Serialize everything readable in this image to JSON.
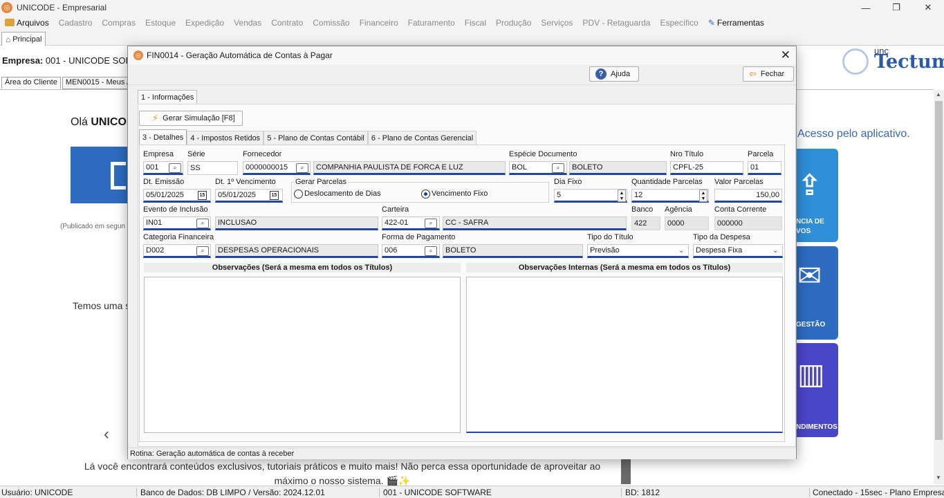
{
  "window": {
    "title": "UNICODE - Empresarial"
  },
  "menu": {
    "items": [
      "Arquivos",
      "Cadastro",
      "Compras",
      "Estoque",
      "Expedição",
      "Vendas",
      "Contrato",
      "Comissão",
      "Financeiro",
      "Faturamento",
      "Fiscal",
      "Produção",
      "Serviços",
      "PDV - Retaguarda",
      "Específico",
      "Ferramentas"
    ]
  },
  "main_tab": {
    "label": "Principal"
  },
  "background": {
    "empresa_label": "Empresa:",
    "empresa_value": "001 - UNICODE SOF",
    "tabs": [
      "Área do Cliente",
      "MEN0015 - Meus Ac"
    ],
    "hello_prefix": "Olá ",
    "hello_name": "UNICOI",
    "published": "(Publicado em segun",
    "temos": "Temos uma s",
    "bottom_text": "Lá você encontrará conteúdos exclusivos, tutoriais práticos e muito mais! Não perca essa oportunidade de aproveitar ao máximo o nosso sistema. 🎬✨",
    "acesso": "Acesso pelo aplicativo.",
    "logo_small": "unc",
    "logo_big": "Tectum",
    "cards": [
      {
        "text1": "NCIA DE",
        "text2": "VOS",
        "color": "#2f8fd8"
      },
      {
        "text1": "GESTÃO",
        "text2": "",
        "color": "#2d6cc0"
      },
      {
        "text1": "NDIMENTOS",
        "text2": "",
        "color": "#4a46c8"
      }
    ]
  },
  "status": {
    "user": "Usuário: UNICODE",
    "db": "Banco de Dados: DB LIMPO / Versão: 2024.12.01",
    "company": "001 - UNICODE SOFTWARE",
    "bd": "BD: 1812",
    "conn": "Conectado - 15sec  -  Plano Empresa"
  },
  "modal": {
    "title": "FIN0014 - Geração Automática de Contas à Pagar",
    "help_label": "Ajuda",
    "close_label": "Fechar",
    "section_tab": "1 - Informações",
    "simulate_label": "Gerar Simulação [F8]",
    "subtabs": [
      "3 - Detalhes",
      "4 - Impostos Retidos",
      "5 - Plano de Contas Contábil",
      "6 - Plano de Contas Gerencial"
    ],
    "fields": {
      "empresa": {
        "label": "Empresa",
        "value": "001"
      },
      "serie": {
        "label": "Série",
        "value": "SS"
      },
      "fornecedor": {
        "label": "Fornecedor",
        "code": "0000000015",
        "name": "COMPANHIA PAULISTA DE FORCA E LUZ"
      },
      "especie": {
        "label": "Espécie Documento",
        "code": "BOL",
        "name": "BOLETO"
      },
      "nro_titulo": {
        "label": "Nro Título",
        "value": "CPFL-25"
      },
      "parcela": {
        "label": "Parcela",
        "value": "01"
      },
      "dt_emissao": {
        "label": "Dt. Emissão",
        "value": "05/01/2025"
      },
      "dt_vencimento": {
        "label": "Dt. 1º Vencimento",
        "value": "05/01/2025"
      },
      "gerar_parcelas": {
        "label": "Gerar Parcelas",
        "opt1": "Deslocamento de Dias",
        "opt2": "Vencimento Fixo",
        "selected": "Vencimento Fixo"
      },
      "dia_fixo": {
        "label": "Dia Fixo",
        "value": "5"
      },
      "qtd_parcelas": {
        "label": "Quantidade Parcelas",
        "value": "12"
      },
      "valor_parcelas": {
        "label": "Valor Parcelas",
        "value": "150,00"
      },
      "evento": {
        "label": "Evento de Inclusão",
        "code": "IN01",
        "name": "INCLUSAO"
      },
      "carteira": {
        "label": "Carteira",
        "code": "422-01",
        "name": "CC - SAFRA"
      },
      "banco": {
        "label": "Banco",
        "value": "422"
      },
      "agencia": {
        "label": "Agência",
        "value": "0000"
      },
      "conta": {
        "label": "Conta Corrente",
        "value": "000000"
      },
      "categoria": {
        "label": "Categoria Financeira",
        "code": "D002",
        "name": "DESPESAS OPERACIONAIS"
      },
      "forma_pgto": {
        "label": "Forma de Pagamento",
        "code": "006",
        "name": "BOLETO"
      },
      "tipo_titulo": {
        "label": "Tipo do Título",
        "value": "Previsão"
      },
      "tipo_despesa": {
        "label": "Tipo da Despesa",
        "value": "Despesa Fixa"
      }
    },
    "obs_label": "Observações (Será a mesma em todos os Títulos)",
    "obs_int_label": "Observações Internas (Será a mesma em todos os Títulos)",
    "status_text": "Rotina: Geração automática de contas à receber"
  }
}
